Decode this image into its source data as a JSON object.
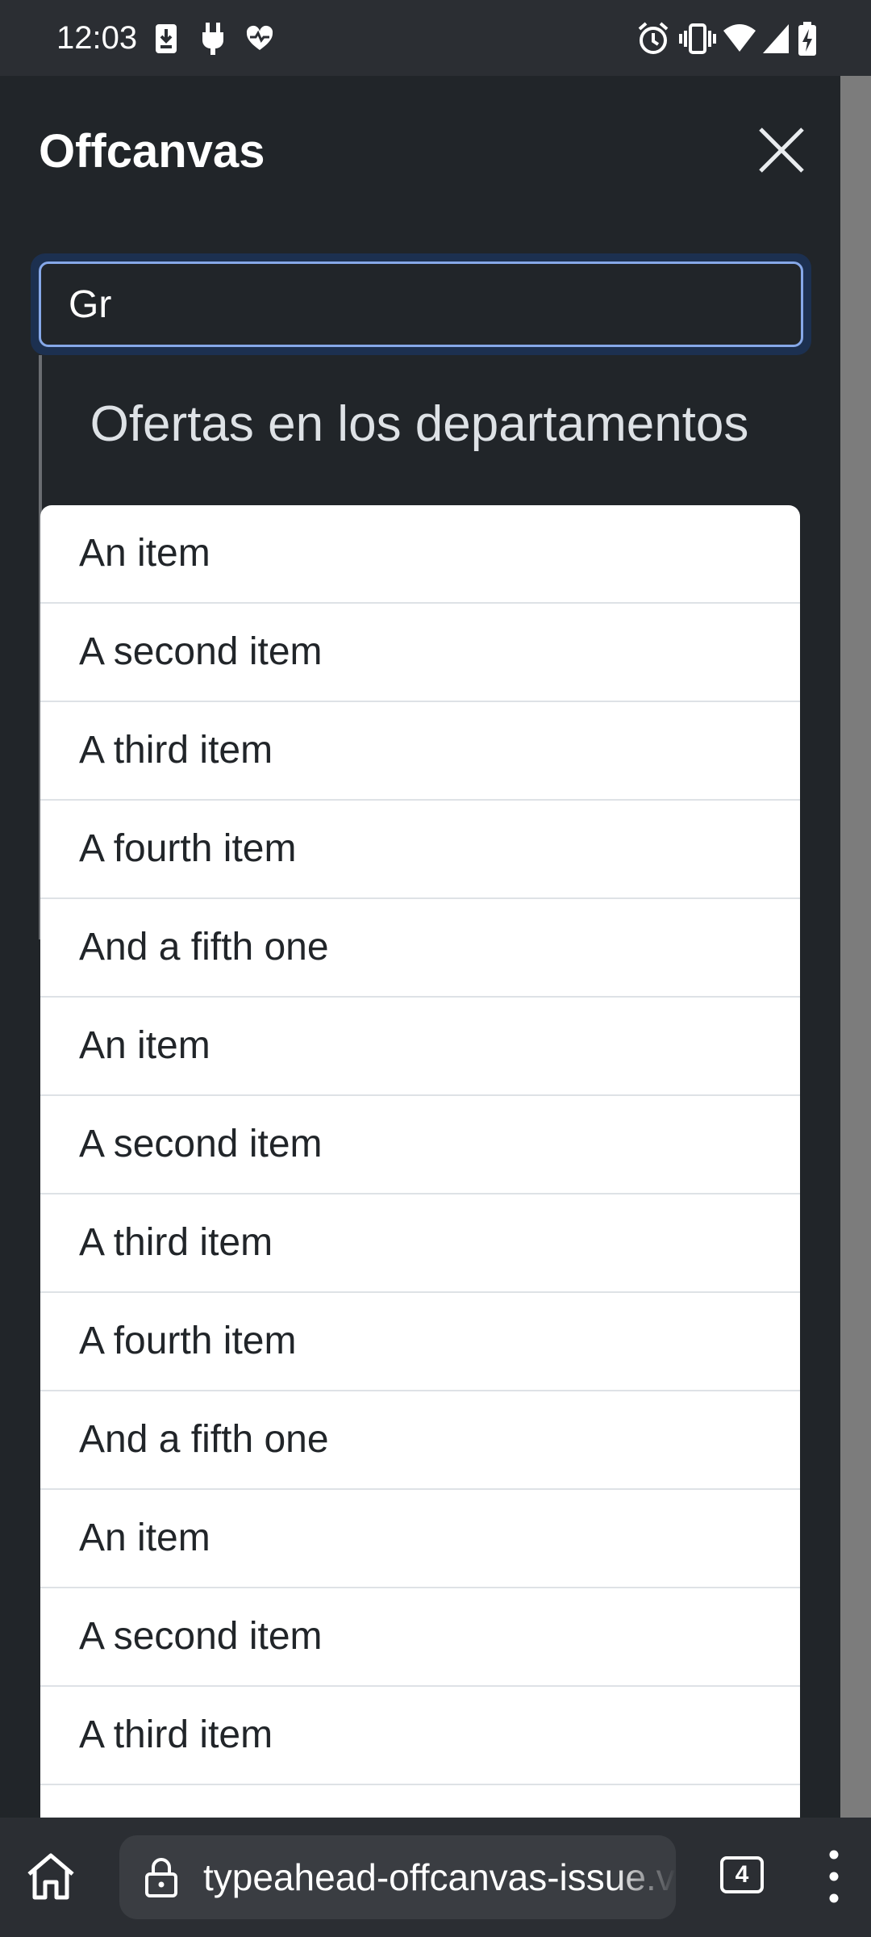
{
  "status_bar": {
    "time": "12:03",
    "left_icons": [
      "download-icon",
      "plug-icon",
      "heart-icon"
    ],
    "right_icons": [
      "alarm-icon",
      "vibrate-icon",
      "wifi-icon",
      "signal-icon",
      "battery-charging-icon"
    ]
  },
  "offcanvas": {
    "title": "Offcanvas",
    "close_icon": "close-icon",
    "search": {
      "value": "Gr"
    },
    "department_heading": "Ofertas en los departamentos",
    "items": [
      {
        "label": "An item"
      },
      {
        "label": "A second item"
      },
      {
        "label": "A third item"
      },
      {
        "label": "A fourth item"
      },
      {
        "label": "And a fifth one"
      },
      {
        "label": "An item"
      },
      {
        "label": "A second item"
      },
      {
        "label": "A third item"
      },
      {
        "label": "A fourth item"
      },
      {
        "label": "And a fifth one"
      },
      {
        "label": "An item"
      },
      {
        "label": "A second item"
      },
      {
        "label": "A third item"
      },
      {
        "label": ""
      }
    ]
  },
  "browser_bar": {
    "url": "typeahead-offcanvas-issue.ve",
    "tab_count": "4",
    "home_icon": "home-icon",
    "lock_icon": "lock-icon",
    "menu_icon": "more-vert-icon"
  },
  "colors": {
    "background": "#212529",
    "focus_ring": "#86a8e8",
    "list_background": "#ffffff"
  }
}
